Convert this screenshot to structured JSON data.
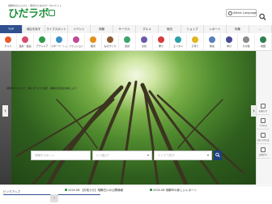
{
  "header": {
    "tagline": "飛騨市のたんけん・発見のためのポータルサイト",
    "logo_text": "ひだラボ",
    "language_label": "Select Language"
  },
  "nav": {
    "items": [
      "TOP",
      "地区を探す",
      "ライブスポット",
      "イベント",
      "体験",
      "サークル",
      "グルメ",
      "宿泊",
      "ショップ",
      "レポート",
      "特集",
      "…"
    ],
    "active_index": 0
  },
  "categories": [
    {
      "label": "グルメ",
      "color": "#e8592a"
    },
    {
      "label": "温泉・宿泊",
      "color": "#d64a6e"
    },
    {
      "label": "アウトドア",
      "color": "#2f9a4e"
    },
    {
      "label": "スポーツ・レジャー",
      "color": "#3a8fc7"
    },
    {
      "label": "ファッション",
      "color": "#c04a98"
    },
    {
      "label": "観光",
      "color": "#e58f1f"
    },
    {
      "label": "ものづくり",
      "color": "#8a5a2e"
    },
    {
      "label": "自然",
      "color": "#3aa56a"
    },
    {
      "label": "文化",
      "color": "#6b5aa8"
    },
    {
      "label": "祭り",
      "color": "#d93a3a"
    },
    {
      "label": "エンタメ",
      "color": "#2aa0a8"
    },
    {
      "label": "子育て",
      "color": "#e2b51f"
    },
    {
      "label": "移住",
      "color": "#5a7fc0"
    },
    {
      "label": "学び",
      "color": "#4a4a9a"
    },
    {
      "label": "その他",
      "color": "#8a8a8a"
    },
    {
      "label": "地図",
      "color": "#2f7f4f"
    }
  ],
  "hero": {
    "caption": "飛騨市の人たちと一緒に見つけた場所 · 飛騨の自然を体感しよう",
    "side_tabs": [
      "お知らせ",
      "アクセス",
      "ひだラボとは",
      "お問合せ"
    ]
  },
  "search": {
    "keyword_placeholder": "体験やスポット",
    "date_placeholder": "いつ遊ぶ？",
    "area_placeholder": "エリアで探す"
  },
  "ticker": {
    "label": "ピックアップ",
    "news": [
      "2020.08  【お知らせ】飛騨古川の公開情報",
      "2020.08  飛騨市の新しいレポート"
    ]
  },
  "colors": {
    "brand": "#1f8f3a",
    "nav_active": "#2f4f8f",
    "search_button": "#1f3f7f"
  }
}
